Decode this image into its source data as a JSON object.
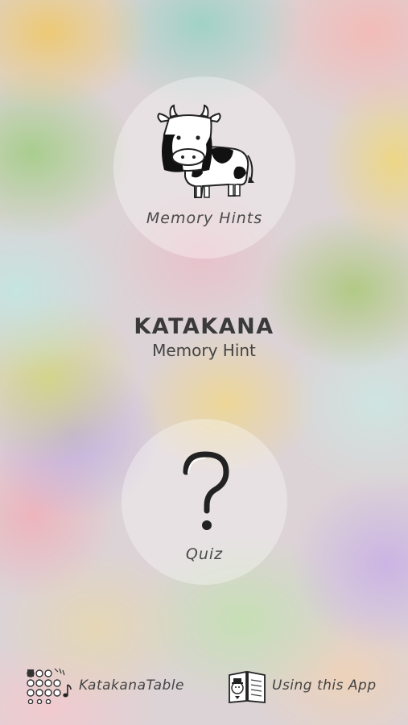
{
  "app": {
    "title": "KATAKANA",
    "subtitle": "Memory Hint"
  },
  "menu": {
    "hints_label": "Memory Hints",
    "hints_icon": "cow-icon",
    "quiz_label": "Quiz",
    "quiz_icon": "question-mark-icon"
  },
  "footer": {
    "table_label": "KatakanaTable",
    "table_icon": "dot-grid-icon",
    "help_label": "Using this App",
    "help_icon": "book-icon"
  }
}
